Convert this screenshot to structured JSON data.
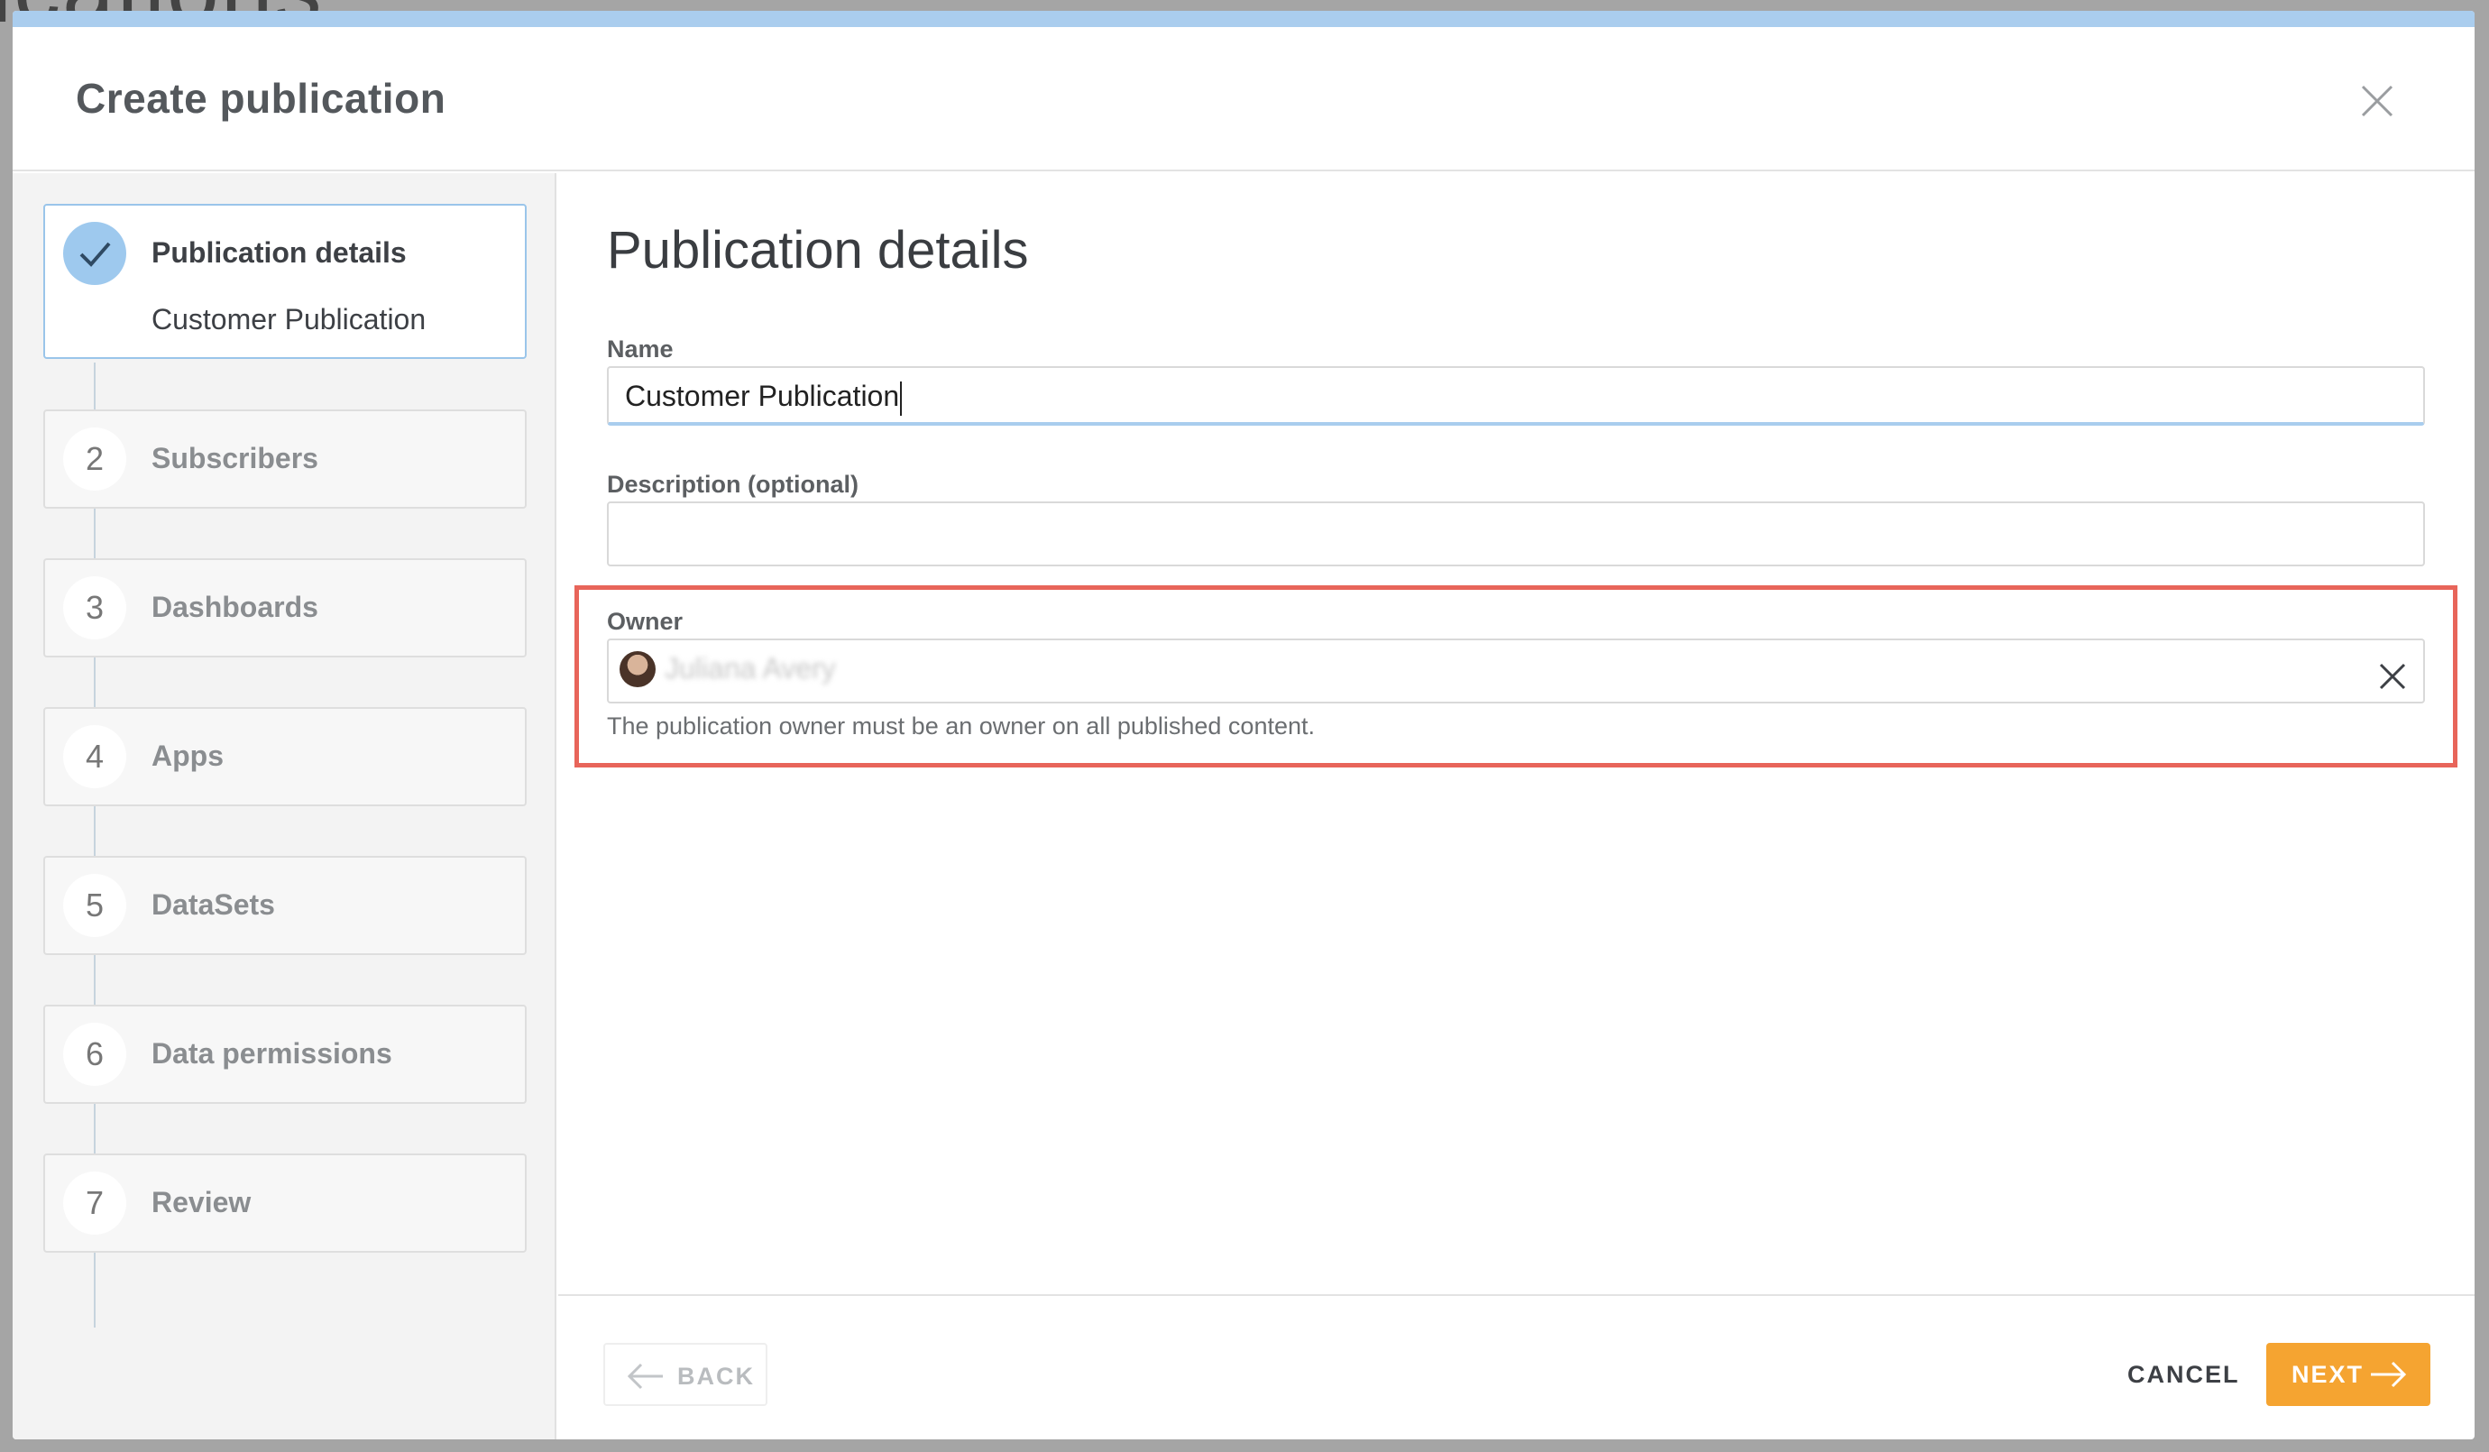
{
  "background": {
    "title_fragment": "ications"
  },
  "dialog": {
    "title": "Create publication"
  },
  "steps": [
    {
      "number": "",
      "label": "Publication details",
      "sub": "Customer Publication",
      "state": "completed"
    },
    {
      "number": "2",
      "label": "Subscribers"
    },
    {
      "number": "3",
      "label": "Dashboards"
    },
    {
      "number": "4",
      "label": "Apps"
    },
    {
      "number": "5",
      "label": "DataSets"
    },
    {
      "number": "6",
      "label": "Data permissions"
    },
    {
      "number": "7",
      "label": "Review"
    }
  ],
  "form": {
    "title": "Publication details",
    "name_label": "Name",
    "name_value": "Customer Publication",
    "description_label": "Description (optional)",
    "description_value": "",
    "owner_label": "Owner",
    "owner_value": "Juliana Avery",
    "owner_help": "The publication owner must be an owner on all published content."
  },
  "footer": {
    "back_label": "BACK",
    "cancel_label": "CANCEL",
    "next_label": "NEXT"
  },
  "colors": {
    "accent": "#aacdee",
    "primary_button": "#f5a431",
    "highlight_box": "#e8655a"
  }
}
